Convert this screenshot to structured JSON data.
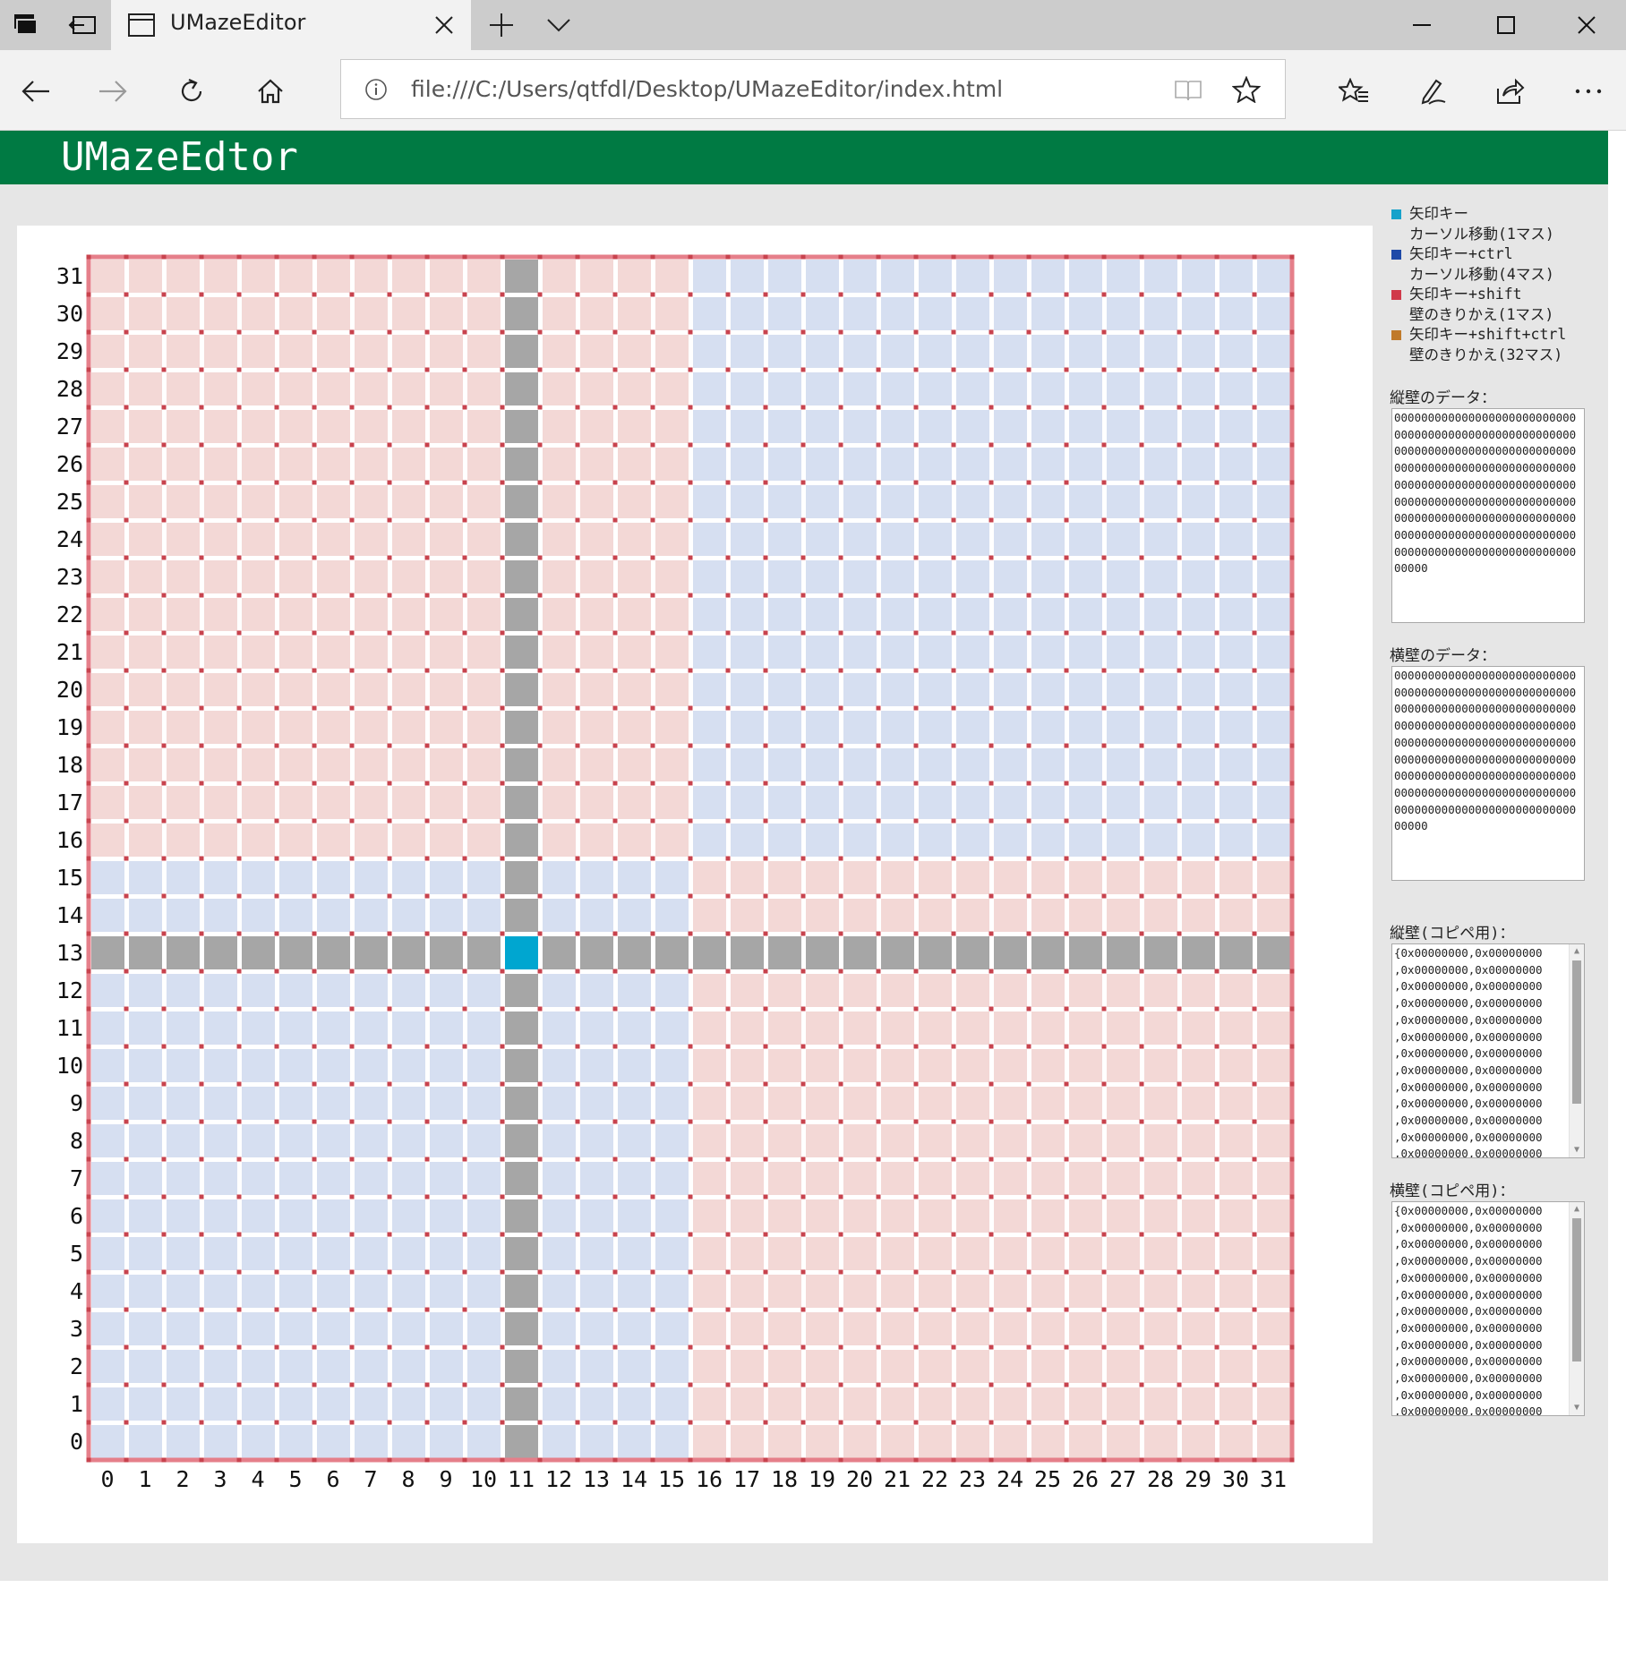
{
  "browser": {
    "tab_title": "UMazeEditor",
    "address": "file:///C:/Users/qtfdl/Desktop/UMazeEditor/index.html"
  },
  "app": {
    "title": "UMazeEdtor"
  },
  "maze": {
    "size": 32,
    "cursor": {
      "x": 11,
      "y": 13
    },
    "colors": {
      "quadrant_red": "#f3d8d6",
      "quadrant_blue": "#d6dff1",
      "highlight": "#a6a6a6",
      "cursor": "#00a6d0",
      "post": "#c8434e",
      "outer_wall": "#e57f8a",
      "axis_label": "#111111"
    },
    "x_labels": [
      "0",
      "1",
      "2",
      "3",
      "4",
      "5",
      "6",
      "7",
      "8",
      "9",
      "10",
      "11",
      "12",
      "13",
      "14",
      "15",
      "16",
      "17",
      "18",
      "19",
      "20",
      "21",
      "22",
      "23",
      "24",
      "25",
      "26",
      "27",
      "28",
      "29",
      "30",
      "31"
    ],
    "y_labels": [
      "0",
      "1",
      "2",
      "3",
      "4",
      "5",
      "6",
      "7",
      "8",
      "9",
      "10",
      "11",
      "12",
      "13",
      "14",
      "15",
      "16",
      "17",
      "18",
      "19",
      "20",
      "21",
      "22",
      "23",
      "24",
      "25",
      "26",
      "27",
      "28",
      "29",
      "30",
      "31"
    ]
  },
  "legend": [
    {
      "color": "#17a2cb",
      "line1": "矢印キー",
      "line2": "カーソル移動(1マス)"
    },
    {
      "color": "#1f4aa8",
      "line1": "矢印キー+ctrl",
      "line2": "カーソル移動(4マス)"
    },
    {
      "color": "#d03a4a",
      "line1": "矢印キー+shift",
      "line2": "壁のきりかえ(1マス)"
    },
    {
      "color": "#c07a2a",
      "line1": "矢印キー+shift+ctrl",
      "line2": "壁のきりかえ(32マス)"
    }
  ],
  "vertical_data": {
    "label": "縦壁のデータ：",
    "value": "00000000000000000000000000000000000000000000000000000000000000000000000000000000000000000000000000000000000000000000000000000000000000000000000000000000000000000000000000000000000000000000000000000000000000000000000000000000000000000000000000000000"
  },
  "horizontal_data": {
    "label": "横壁のデータ：",
    "value": "00000000000000000000000000000000000000000000000000000000000000000000000000000000000000000000000000000000000000000000000000000000000000000000000000000000000000000000000000000000000000000000000000000000000000000000000000000000000000000000000000000000"
  },
  "vertical_copy": {
    "label": "縦壁(コピペ用)：",
    "lines": [
      "{0x00000000,0x00000000",
      ",0x00000000,0x00000000",
      ",0x00000000,0x00000000",
      ",0x00000000,0x00000000",
      ",0x00000000,0x00000000",
      ",0x00000000,0x00000000",
      ",0x00000000,0x00000000",
      ",0x00000000,0x00000000",
      ",0x00000000,0x00000000",
      ",0x00000000,0x00000000",
      ",0x00000000,0x00000000",
      ",0x00000000,0x00000000",
      ",0x00000000,0x00000000"
    ]
  },
  "horizontal_copy": {
    "label": "横壁(コピペ用)：",
    "lines": [
      "{0x00000000,0x00000000",
      ",0x00000000,0x00000000",
      ",0x00000000,0x00000000",
      ",0x00000000,0x00000000",
      ",0x00000000,0x00000000",
      ",0x00000000,0x00000000",
      ",0x00000000,0x00000000",
      ",0x00000000,0x00000000",
      ",0x00000000,0x00000000",
      ",0x00000000,0x00000000",
      ",0x00000000,0x00000000",
      ",0x00000000,0x00000000",
      ",0x00000000,0x00000000"
    ]
  }
}
